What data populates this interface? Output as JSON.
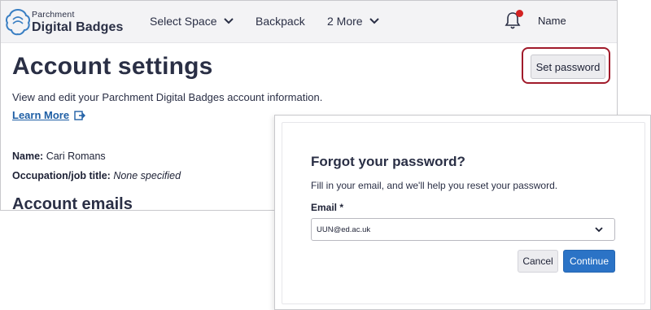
{
  "header": {
    "logo_small": "Parchment",
    "logo_big": "Digital Badges",
    "nav": [
      {
        "label": "Select Space"
      },
      {
        "label": "Backpack"
      },
      {
        "label": "2 More"
      }
    ],
    "user_name": "Name",
    "notification_color": "#d32222"
  },
  "page": {
    "title": "Account settings",
    "description": "View and edit your Parchment Digital Badges account information.",
    "learn_more": "Learn More",
    "set_password_label": "Set password",
    "name_label": "Name:",
    "name_value": "Cari Romans",
    "occupation_label": "Occupation/job title:",
    "occupation_value": "None specified",
    "section_title": "Account emails",
    "highlight_color": "#a11b2b"
  },
  "modal": {
    "title": "Forgot your password?",
    "description": "Fill in your email, and we'll help you reset your password.",
    "email_label": "Email *",
    "email_value": "UUN@ed.ac.uk",
    "cancel_label": "Cancel",
    "continue_label": "Continue",
    "accent_color": "#2b73c6"
  }
}
